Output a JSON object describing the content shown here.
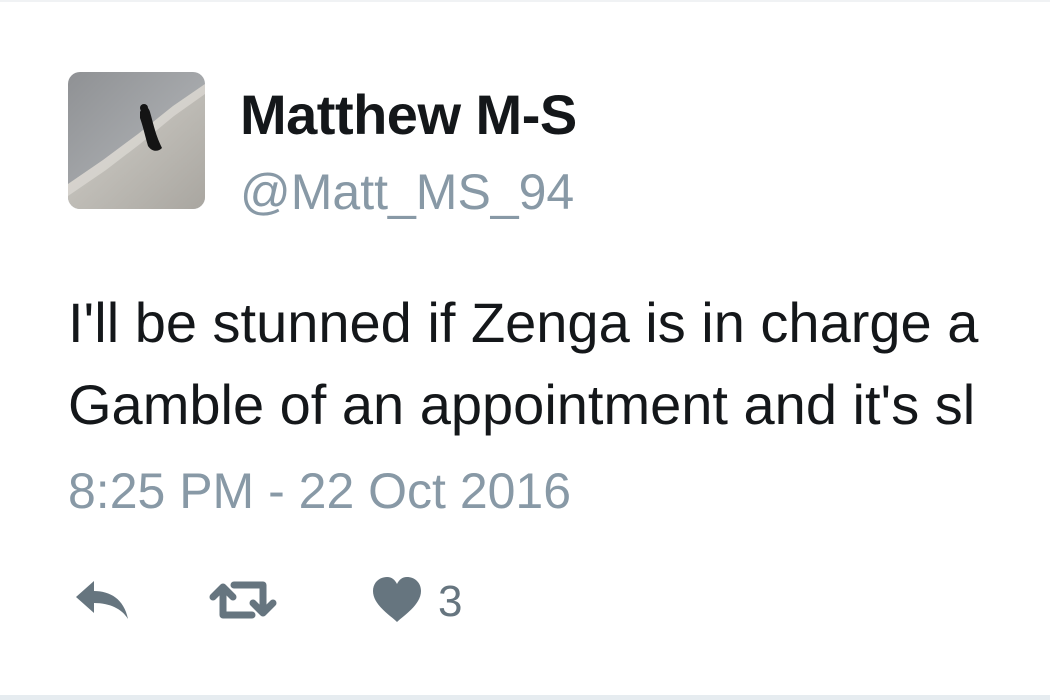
{
  "tweet": {
    "author_name": "Matthew M-S",
    "author_handle": "@Matt_MS_94",
    "text_lines": [
      "I'll be stunned if Zenga is in charge a",
      "Gamble of an appointment and it's sl"
    ],
    "timestamp": "8:25 PM - 22 Oct 2016",
    "likes_count": "3"
  },
  "icons": {
    "reply": "reply-icon",
    "retweet": "retweet-icon",
    "like": "heart-icon"
  },
  "colors": {
    "text": "#14171a",
    "muted": "#8899a6",
    "action": "#66757f",
    "divider": "#e6ecf0"
  }
}
